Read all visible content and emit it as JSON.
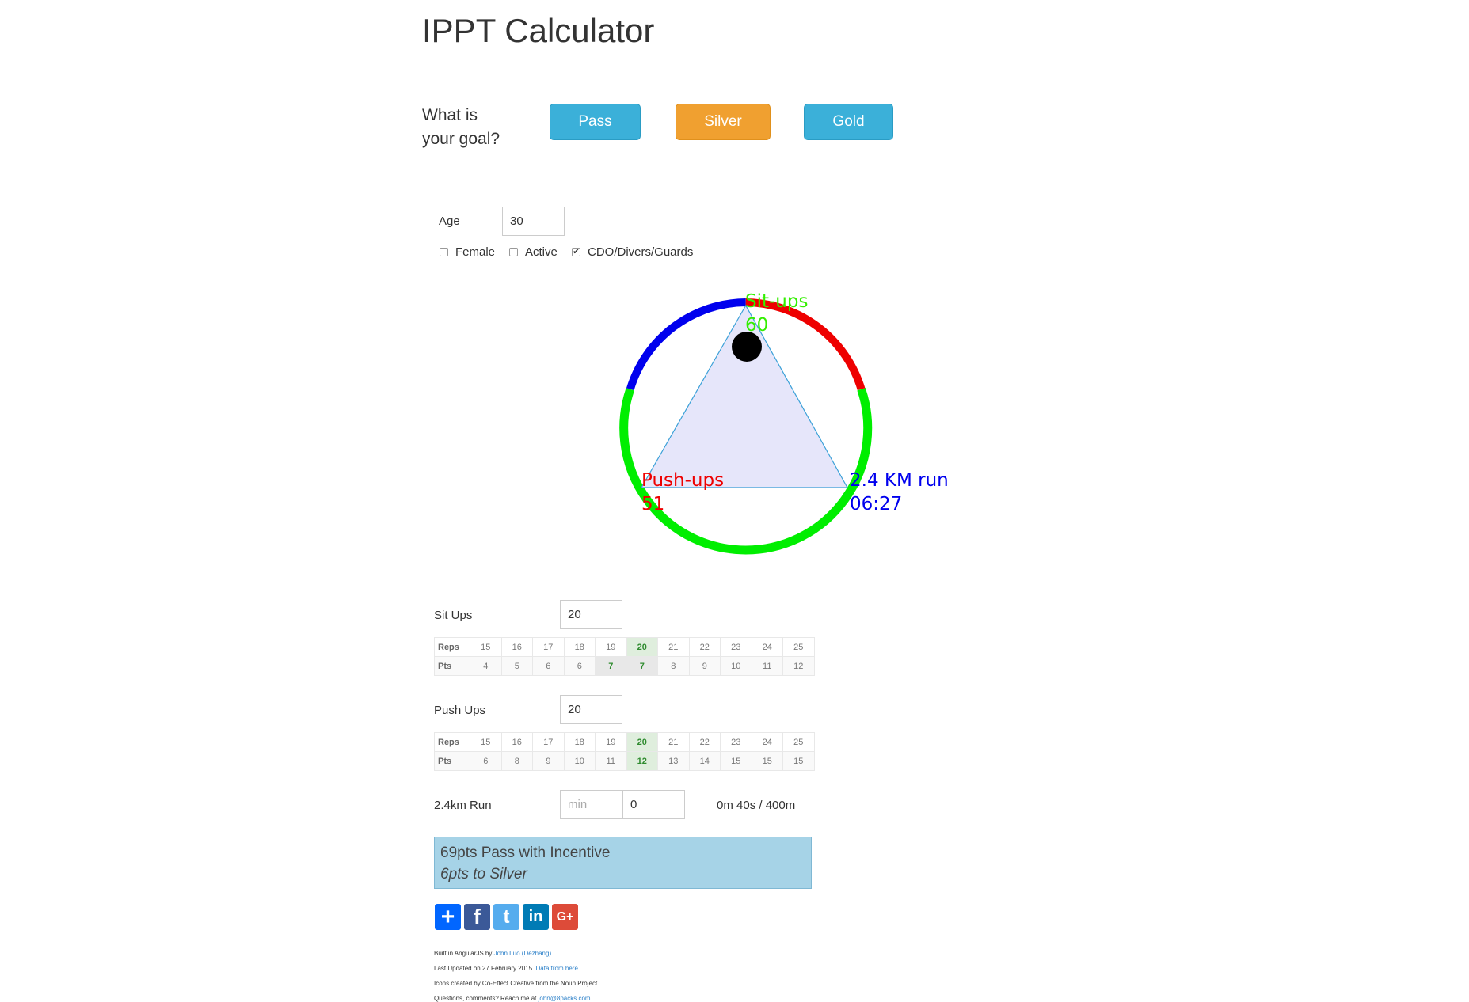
{
  "title": "IPPT Calculator",
  "goal": {
    "label_line1": "What is",
    "label_line2": "your goal?",
    "buttons": [
      {
        "label": "Pass",
        "color": "#3bb0d9"
      },
      {
        "label": "Silver",
        "color": "#f0a030"
      },
      {
        "label": "Gold",
        "color": "#3bb0d9"
      }
    ]
  },
  "age": {
    "label": "Age",
    "value": "30"
  },
  "checkboxes": [
    {
      "label": "Female",
      "checked": false
    },
    {
      "label": "Active",
      "checked": false
    },
    {
      "label": "CDO/Divers/Guards",
      "checked": true
    }
  ],
  "radar": {
    "situps": {
      "label": "Sit-ups",
      "value": "60",
      "color": "#33ee00"
    },
    "pushups": {
      "label": "Push-ups",
      "value": "51",
      "color": "#ff0000"
    },
    "run": {
      "label": "2.4 KM run",
      "value": "06:27",
      "color": "#0000ee"
    }
  },
  "situps": {
    "label": "Sit Ups",
    "value": "20",
    "table": {
      "reps_label": "Reps",
      "pts_label": "Pts",
      "reps": [
        "15",
        "16",
        "17",
        "18",
        "19",
        "20",
        "21",
        "22",
        "23",
        "24",
        "25"
      ],
      "pts": [
        "4",
        "5",
        "6",
        "6",
        "7",
        "7",
        "8",
        "9",
        "10",
        "11",
        "12"
      ]
    }
  },
  "pushups": {
    "label": "Push Ups",
    "value": "20",
    "table": {
      "reps_label": "Reps",
      "pts_label": "Pts",
      "reps": [
        "15",
        "16",
        "17",
        "18",
        "19",
        "20",
        "21",
        "22",
        "23",
        "24",
        "25"
      ],
      "pts": [
        "6",
        "8",
        "9",
        "10",
        "11",
        "12",
        "13",
        "14",
        "15",
        "15",
        "15"
      ]
    }
  },
  "run": {
    "label": "2.4km Run",
    "min_placeholder": "min",
    "sec_value": "0",
    "pace": "0m 40s / 400m"
  },
  "result": {
    "line1": "69pts Pass with Incentive",
    "line2": "6pts to Silver"
  },
  "share": [
    {
      "name": "share-plus-icon",
      "glyph": "+",
      "color": "#0166ff"
    },
    {
      "name": "facebook-icon",
      "glyph": "f",
      "color": "#3b5998"
    },
    {
      "name": "twitter-icon",
      "glyph": "t",
      "color": "#55acee"
    },
    {
      "name": "linkedin-icon",
      "glyph": "in",
      "color": "#007bb5"
    },
    {
      "name": "google-plus-icon",
      "glyph": "G+",
      "color": "#dd4b39"
    }
  ],
  "footer": {
    "built_prefix": "Built in AngularJS by ",
    "built_link": "John Luo (Dezhang)",
    "updated_prefix": "Last Updated on 27 February 2015. ",
    "updated_link": "Data from here.",
    "icons_credit": "Icons created by Co-Effect Creative from the Noun Project",
    "contact_prefix": "Questions, comments? Reach me at ",
    "contact_link": "john@8packs.com"
  }
}
